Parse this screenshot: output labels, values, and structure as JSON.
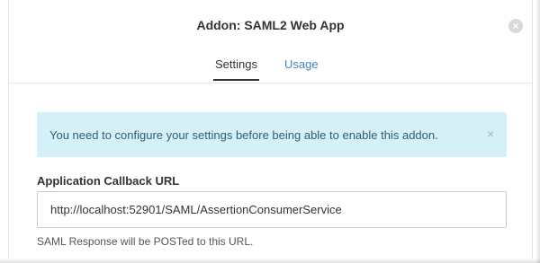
{
  "dialog": {
    "title": "Addon: SAML2 Web App",
    "close_icon": "close-circle-icon",
    "close_glyph": "×"
  },
  "tabs": [
    {
      "label": "Settings",
      "active": true
    },
    {
      "label": "Usage",
      "active": false
    }
  ],
  "alert": {
    "message": "You need to configure your settings before being able to enable this addon.",
    "dismiss_glyph": "×",
    "background": "#d6f0f7"
  },
  "callback_url": {
    "label": "Application Callback URL",
    "value": "http://localhost:52901/SAML/AssertionConsumerService",
    "help": "SAML Response will be POSTed to this URL."
  },
  "colors": {
    "link": "#3f86c5",
    "text": "#333333"
  }
}
